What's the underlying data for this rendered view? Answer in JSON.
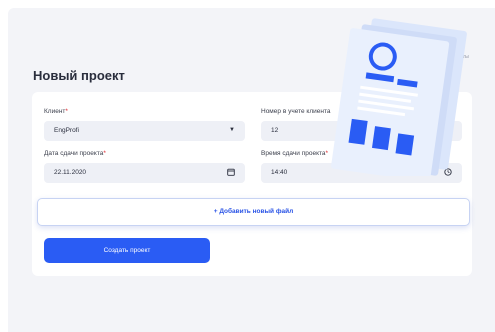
{
  "page": {
    "title": "Новый проект",
    "side_label": "онтакты"
  },
  "form": {
    "client": {
      "label": "Клиент",
      "required_mark": "*",
      "value": "EngProfi"
    },
    "client_number": {
      "label": "Номер в учете клиента",
      "value": "12"
    },
    "due_date": {
      "label": "Дата сдачи проекта",
      "required_mark": "*",
      "value": "22.11.2020"
    },
    "due_time": {
      "label": "Время сдачи проекта",
      "required_mark": "*",
      "value": "14:40"
    },
    "add_file_label": "+ Добавить новый файл",
    "create_button_label": "Создать проект"
  },
  "icons": {
    "select_arrow": "dropdown-arrow-icon",
    "calendar": "calendar-icon",
    "clock": "clock-icon"
  },
  "colors": {
    "accent": "#2a5cf4",
    "required": "#e0242a",
    "field_bg": "#eef0f6"
  }
}
